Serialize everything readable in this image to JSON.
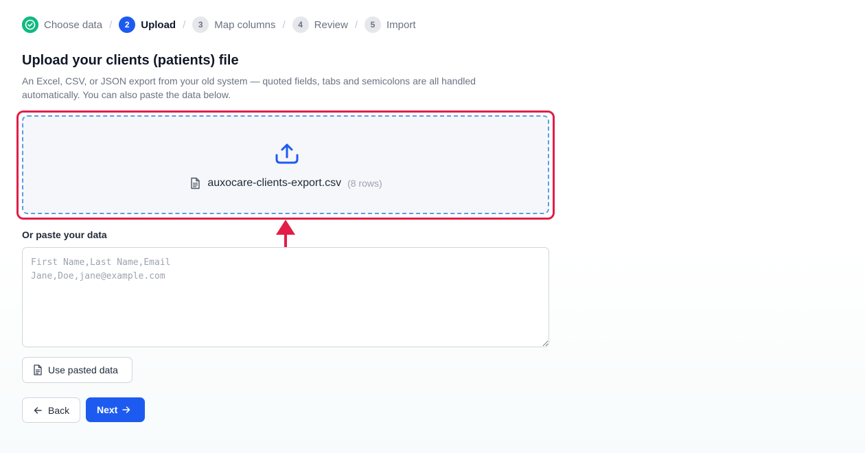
{
  "stepper": {
    "steps": [
      {
        "number": "",
        "label": "Choose data",
        "state": "done"
      },
      {
        "number": "2",
        "label": "Upload",
        "state": "active"
      },
      {
        "number": "3",
        "label": "Map columns",
        "state": "pending"
      },
      {
        "number": "4",
        "label": "Review",
        "state": "pending"
      },
      {
        "number": "5",
        "label": "Import",
        "state": "pending"
      }
    ],
    "separator": "/"
  },
  "header": {
    "title": "Upload your clients (patients) file",
    "description": "An Excel, CSV, or JSON export from your old system — quoted fields, tabs and semicolons are all handled automatically. You can also paste the data below."
  },
  "dropzone": {
    "icon": "upload-icon",
    "file_icon": "file-icon",
    "file_name": "auxocare-clients-export.csv",
    "row_count": "(8 rows)"
  },
  "paste": {
    "label": "Or paste your data",
    "value": "",
    "placeholder": "First Name,Last Name,Email\nJane,Doe,jane@example.com",
    "use_button": "Use pasted data"
  },
  "nav": {
    "back_label": "Back",
    "next_label": "Next"
  },
  "colors": {
    "primary": "#1d5bf0",
    "success": "#10b981",
    "highlight": "#e11d48",
    "dropzone_border": "#5b9be8"
  }
}
